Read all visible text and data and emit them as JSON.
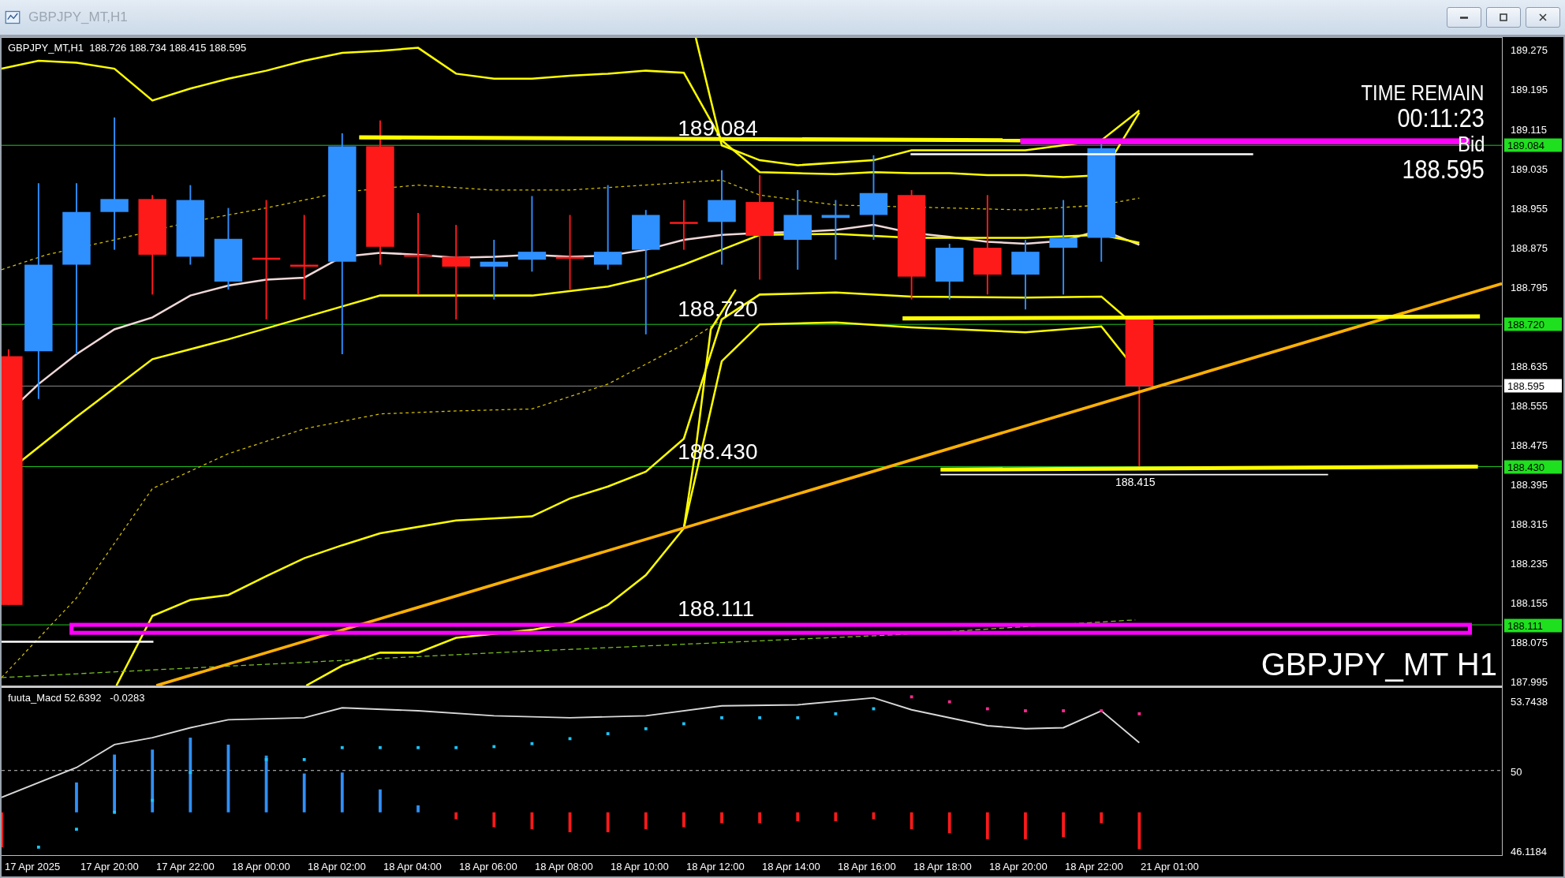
{
  "window": {
    "title": "GBPJPY_MT,H1"
  },
  "chart": {
    "header": "GBPJPY_MT,H1  188.726 188.734 188.415 188.595",
    "level_labels": [
      "189.084",
      "188.720",
      "188.430",
      "188.111"
    ],
    "low_label": "188.415",
    "timer": {
      "title": "TIME REMAIN",
      "time": "00:11:23",
      "bid_label": "Bid",
      "bid": "188.595"
    },
    "symbol_label": "GBPJPY_MT H1"
  },
  "price_axis": {
    "ticks": [
      "189.275",
      "189.195",
      "189.115",
      "189.035",
      "188.955",
      "188.875",
      "188.795",
      "188.635",
      "188.555",
      "188.475",
      "188.395",
      "188.315",
      "188.235",
      "188.155",
      "188.075",
      "187.995"
    ],
    "markers": [
      {
        "text": "189.084",
        "kind": "line"
      },
      {
        "text": "188.720",
        "kind": "line"
      },
      {
        "text": "188.595",
        "kind": "bid"
      },
      {
        "text": "188.430",
        "kind": "line"
      },
      {
        "text": "188.111",
        "kind": "line"
      }
    ]
  },
  "macd": {
    "header": "fuuta_Macd 52.6392   -0.0283",
    "ticks": [
      "53.7438",
      "50",
      "46.1184"
    ]
  },
  "time_axis": [
    "17 Apr 2025",
    "17 Apr 20:00",
    "17 Apr 22:00",
    "18 Apr 00:00",
    "18 Apr 02:00",
    "18 Apr 04:00",
    "18 Apr 06:00",
    "18 Apr 08:00",
    "18 Apr 10:00",
    "18 Apr 12:00",
    "18 Apr 14:00",
    "18 Apr 16:00",
    "18 Apr 18:00",
    "18 Apr 20:00",
    "18 Apr 22:00",
    "21 Apr 01:00"
  ]
}
